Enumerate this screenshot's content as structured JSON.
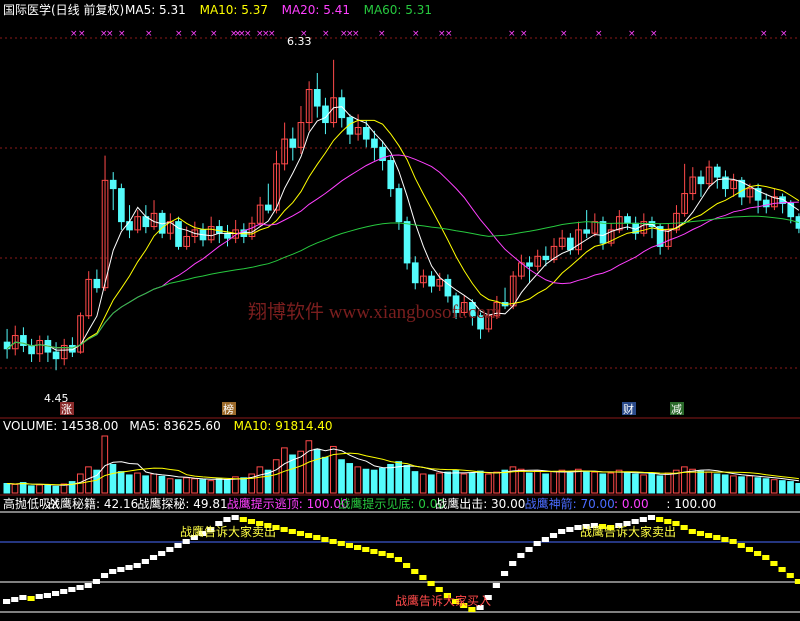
{
  "colors": {
    "bg": "#000000",
    "up": "#ff4a4a",
    "down": "#54fcfc",
    "white": "#ffffff",
    "yellow": "#ffff00",
    "magenta": "#ff40ff",
    "green": "#27c93f",
    "grid": "#8a1a1a",
    "blue": "#4a6cff"
  },
  "price_panel": {
    "title": "国际医学(日线 前复权)",
    "ma_legend": [
      {
        "label": "MA5: 5.31",
        "color": "#ffffff"
      },
      {
        "label": "MA10: 5.37",
        "color": "#ffff00"
      },
      {
        "label": "MA20: 5.41",
        "color": "#ff40ff"
      },
      {
        "label": "MA60: 5.31",
        "color": "#27c93f"
      }
    ],
    "high_label": "6.33",
    "low_label": "4.45",
    "watermark": "翔博软件 www.xiangbosoft.com",
    "event_badges": [
      {
        "text": "涨",
        "bg": "#8a2a2a",
        "fg": "#ffffff"
      },
      {
        "text": "榜",
        "bg": "#9c6a2a",
        "fg": "#ffffff"
      },
      {
        "text": "财",
        "bg": "#2a4a8a",
        "fg": "#ffffff"
      },
      {
        "text": "减",
        "bg": "#2a6a2a",
        "fg": "#ffffff"
      }
    ]
  },
  "volume_panel": {
    "legend": [
      {
        "label": "VOLUME: 14538.00",
        "color": "#ffffff"
      },
      {
        "label": "MA5: 83625.60",
        "color": "#ffffff"
      },
      {
        "label": "MA10: 91814.40",
        "color": "#ffff00"
      }
    ]
  },
  "indicator_panel": {
    "legend": [
      {
        "label": "高抛低吸X",
        "color": "#ffffff"
      },
      {
        "label": "战鹰秘籍: 42.16",
        "color": "#ffffff"
      },
      {
        "label": "战鹰探秘: 49.81",
        "color": "#ffffff"
      },
      {
        "label": "战鹰提示逃顶: 100.00",
        "color": "#ff40ff"
      },
      {
        "label": "战鹰提示见底: 0.00",
        "color": "#27c93f"
      },
      {
        "label": "战鹰出击: 30.00",
        "color": "#ffffff"
      },
      {
        "label": "战鹰神箭: 70.00",
        "color": "#4a6cff"
      },
      {
        "label": ": 0.00",
        "color": "#ff40ff"
      },
      {
        "label": ": 100.00",
        "color": "#ffffff"
      }
    ],
    "sell_label": "战鹰告诉大家卖出",
    "buy_label": "战鹰告诉大家买入"
  },
  "chart_data": {
    "type": "candlestick",
    "ylim": [
      4.3,
      6.45
    ],
    "candles": [
      [
        4.62,
        4.58,
        4.7,
        4.52
      ],
      [
        4.58,
        4.66,
        4.72,
        4.54
      ],
      [
        4.66,
        4.6,
        4.71,
        4.56
      ],
      [
        4.6,
        4.55,
        4.64,
        4.5
      ],
      [
        4.55,
        4.63,
        4.66,
        4.5
      ],
      [
        4.63,
        4.56,
        4.66,
        4.5
      ],
      [
        4.56,
        4.52,
        4.62,
        4.45
      ],
      [
        4.52,
        4.6,
        4.64,
        4.48
      ],
      [
        4.6,
        4.56,
        4.65,
        4.53
      ],
      [
        4.56,
        4.78,
        4.8,
        4.55
      ],
      [
        4.78,
        5.0,
        5.05,
        4.76
      ],
      [
        5.0,
        4.95,
        5.06,
        4.92
      ],
      [
        4.95,
        5.6,
        5.75,
        4.93
      ],
      [
        5.6,
        5.55,
        5.65,
        5.42
      ],
      [
        5.55,
        5.35,
        5.58,
        5.3
      ],
      [
        5.35,
        5.3,
        5.45,
        5.25
      ],
      [
        5.3,
        5.38,
        5.42,
        5.28
      ],
      [
        5.38,
        5.32,
        5.45,
        5.28
      ],
      [
        5.32,
        5.4,
        5.48,
        5.3
      ],
      [
        5.4,
        5.28,
        5.42,
        5.25
      ],
      [
        5.28,
        5.35,
        5.4,
        5.24
      ],
      [
        5.35,
        5.2,
        5.38,
        5.18
      ],
      [
        5.2,
        5.26,
        5.32,
        5.18
      ],
      [
        5.26,
        5.3,
        5.35,
        5.22
      ],
      [
        5.3,
        5.24,
        5.34,
        5.2
      ],
      [
        5.24,
        5.32,
        5.38,
        5.22
      ],
      [
        5.32,
        5.28,
        5.36,
        5.22
      ],
      [
        5.28,
        5.25,
        5.33,
        5.2
      ],
      [
        5.25,
        5.3,
        5.36,
        5.22
      ],
      [
        5.3,
        5.26,
        5.34,
        5.22
      ],
      [
        5.26,
        5.34,
        5.38,
        5.24
      ],
      [
        5.34,
        5.45,
        5.5,
        5.32
      ],
      [
        5.45,
        5.42,
        5.58,
        5.4
      ],
      [
        5.42,
        5.7,
        5.78,
        5.4
      ],
      [
        5.7,
        5.85,
        5.95,
        5.66
      ],
      [
        5.85,
        5.8,
        5.92,
        5.72
      ],
      [
        5.8,
        5.95,
        6.05,
        5.76
      ],
      [
        5.95,
        6.15,
        6.2,
        5.9
      ],
      [
        6.15,
        6.05,
        6.25,
        5.98
      ],
      [
        6.05,
        5.95,
        6.1,
        5.88
      ],
      [
        5.95,
        6.1,
        6.33,
        5.92
      ],
      [
        6.1,
        5.98,
        6.15,
        5.92
      ],
      [
        5.98,
        5.88,
        6.0,
        5.82
      ],
      [
        5.88,
        5.92,
        6.0,
        5.84
      ],
      [
        5.92,
        5.85,
        5.96,
        5.8
      ],
      [
        5.85,
        5.8,
        5.9,
        5.72
      ],
      [
        5.8,
        5.72,
        5.84,
        5.66
      ],
      [
        5.72,
        5.55,
        5.75,
        5.5
      ],
      [
        5.55,
        5.35,
        5.58,
        5.3
      ],
      [
        5.35,
        5.1,
        5.38,
        5.06
      ],
      [
        5.1,
        4.98,
        5.14,
        4.94
      ],
      [
        4.98,
        5.02,
        5.06,
        4.95
      ],
      [
        5.02,
        4.96,
        5.05,
        4.92
      ],
      [
        4.96,
        5.0,
        5.04,
        4.93
      ],
      [
        5.0,
        4.9,
        5.03,
        4.86
      ],
      [
        4.9,
        4.8,
        4.92,
        4.76
      ],
      [
        4.8,
        4.86,
        4.9,
        4.78
      ],
      [
        4.86,
        4.78,
        4.88,
        4.72
      ],
      [
        4.78,
        4.7,
        4.8,
        4.64
      ],
      [
        4.7,
        4.78,
        4.82,
        4.68
      ],
      [
        4.78,
        4.86,
        4.9,
        4.76
      ],
      [
        4.86,
        4.84,
        4.95,
        4.82
      ],
      [
        4.84,
        5.02,
        5.05,
        4.82
      ],
      [
        5.02,
        5.1,
        5.15,
        5.0
      ],
      [
        5.1,
        5.08,
        5.14,
        4.98
      ],
      [
        5.08,
        5.14,
        5.18,
        5.05
      ],
      [
        5.14,
        5.12,
        5.2,
        5.08
      ],
      [
        5.12,
        5.2,
        5.25,
        5.1
      ],
      [
        5.2,
        5.25,
        5.3,
        5.18
      ],
      [
        5.25,
        5.18,
        5.28,
        5.15
      ],
      [
        5.18,
        5.3,
        5.35,
        5.15
      ],
      [
        5.3,
        5.28,
        5.42,
        5.25
      ],
      [
        5.28,
        5.35,
        5.4,
        5.26
      ],
      [
        5.35,
        5.22,
        5.38,
        5.18
      ],
      [
        5.22,
        5.3,
        5.34,
        5.2
      ],
      [
        5.3,
        5.38,
        5.42,
        5.28
      ],
      [
        5.38,
        5.34,
        5.4,
        5.3
      ],
      [
        5.34,
        5.28,
        5.38,
        5.24
      ],
      [
        5.28,
        5.35,
        5.4,
        5.26
      ],
      [
        5.35,
        5.32,
        5.38,
        5.25
      ],
      [
        5.32,
        5.2,
        5.34,
        5.15
      ],
      [
        5.2,
        5.3,
        5.34,
        5.18
      ],
      [
        5.3,
        5.4,
        5.45,
        5.28
      ],
      [
        5.4,
        5.52,
        5.7,
        5.38
      ],
      [
        5.52,
        5.62,
        5.68,
        5.48
      ],
      [
        5.62,
        5.58,
        5.66,
        5.5
      ],
      [
        5.58,
        5.68,
        5.72,
        5.55
      ],
      [
        5.68,
        5.62,
        5.7,
        5.55
      ],
      [
        5.62,
        5.55,
        5.66,
        5.5
      ],
      [
        5.55,
        5.6,
        5.64,
        5.5
      ],
      [
        5.6,
        5.5,
        5.62,
        5.45
      ],
      [
        5.5,
        5.55,
        5.58,
        5.46
      ],
      [
        5.55,
        5.48,
        5.58,
        5.4
      ],
      [
        5.48,
        5.44,
        5.52,
        5.4
      ],
      [
        5.44,
        5.5,
        5.55,
        5.42
      ],
      [
        5.5,
        5.46,
        5.52,
        5.4
      ],
      [
        5.46,
        5.38,
        5.48,
        5.34
      ],
      [
        5.38,
        5.31,
        5.4,
        5.28
      ]
    ],
    "volume": [
      20,
      18,
      22,
      15,
      17,
      16,
      14,
      19,
      24,
      40,
      55,
      48,
      120,
      60,
      45,
      38,
      42,
      36,
      40,
      35,
      30,
      28,
      32,
      30,
      28,
      26,
      30,
      28,
      34,
      32,
      40,
      55,
      48,
      70,
      95,
      80,
      88,
      110,
      92,
      75,
      98,
      70,
      62,
      55,
      50,
      48,
      52,
      60,
      66,
      58,
      45,
      40,
      38,
      42,
      44,
      48,
      40,
      42,
      46,
      40,
      44,
      48,
      55,
      50,
      42,
      46,
      40,
      45,
      48,
      42,
      50,
      46,
      44,
      40,
      42,
      48,
      44,
      40,
      38,
      40,
      36,
      42,
      48,
      55,
      50,
      46,
      44,
      40,
      38,
      36,
      34,
      36,
      32,
      30,
      28,
      26,
      24,
      20
    ],
    "indicator": [
      10,
      12,
      14,
      13,
      15,
      16,
      18,
      20,
      22,
      24,
      26,
      30,
      36,
      40,
      42,
      44,
      46,
      50,
      54,
      58,
      62,
      66,
      70,
      74,
      78,
      82,
      88,
      92,
      94,
      92,
      90,
      88,
      86,
      84,
      82,
      80,
      78,
      76,
      74,
      72,
      70,
      68,
      66,
      64,
      62,
      60,
      58,
      56,
      52,
      46,
      40,
      34,
      28,
      22,
      16,
      10,
      6,
      2,
      4,
      14,
      26,
      38,
      48,
      56,
      62,
      68,
      72,
      76,
      80,
      82,
      84,
      85,
      86,
      85,
      84,
      86,
      88,
      90,
      92,
      94,
      92,
      90,
      88,
      84,
      80,
      78,
      76,
      74,
      72,
      70,
      66,
      62,
      58,
      54,
      48,
      42,
      36,
      30
    ]
  }
}
